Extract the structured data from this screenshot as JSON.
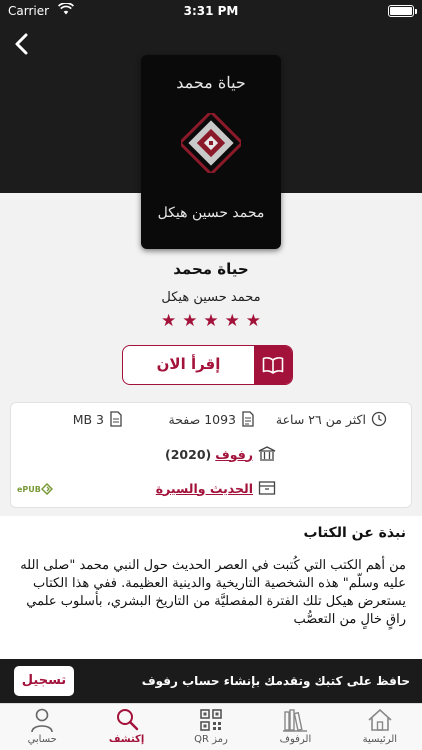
{
  "status_bar": {
    "carrier": "Carrier",
    "time": "3:31 PM"
  },
  "book": {
    "cover_title": "حياة محمد",
    "cover_author": "محمد حسين هيكل",
    "title": "حياة محمد",
    "author": "محمد حسين هيكل",
    "rating_stars": 5,
    "star_color": "#a3123a"
  },
  "read_button": {
    "label": "إقرأ الان"
  },
  "info": {
    "duration": "اكثر من ٢٦ ساعة",
    "pages": "1093 صفحة",
    "size": "3 MB",
    "publisher": "رفوف",
    "year": "(2020)",
    "category": "الحديث والسيرة",
    "format": "ePUB"
  },
  "about": {
    "heading": "نبذة عن الكتاب",
    "text": "من أهم الكتب التي كُتبت في العصر الحديث حول النبي محمد \"صلى الله عليه وسلّم\" هذه الشخصية التاريخية والدينية العظيمة. ففي هذا الكتاب يستعرض هيكل تلك الفترة المفصليَّة من التاريخ البشري، بأسلوب علمي راقٍ خالٍ من التعصُّب"
  },
  "signup_bar": {
    "message": "حافظ على كتبك وتقدمك بإنشاء حساب رفوف",
    "button": "تسجيل"
  },
  "tabs": [
    {
      "label": "حسابي",
      "icon": "person-icon",
      "active": false
    },
    {
      "label": "إكتشف",
      "icon": "search-icon",
      "active": true
    },
    {
      "label": "رمز QR",
      "icon": "qr-code-icon",
      "active": false
    },
    {
      "label": "الرفوف",
      "icon": "shelves-icon",
      "active": false
    },
    {
      "label": "الرئيسية",
      "icon": "home-icon",
      "active": false
    }
  ],
  "colors": {
    "accent": "#a3123a",
    "dark": "#1b1b1b"
  }
}
